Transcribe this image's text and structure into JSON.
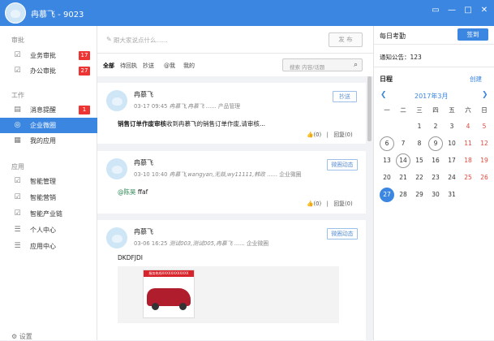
{
  "window": {
    "title": "冉慕飞 - 9023",
    "controls": [
      "▭",
      "—",
      "□",
      "✕"
    ]
  },
  "sidebar": {
    "sections": [
      {
        "title": "审批",
        "items": [
          {
            "label": "业务审批",
            "icon": "checkbox-icon",
            "badge": "17"
          },
          {
            "label": "办公审批",
            "icon": "checkbox-icon",
            "badge": "27"
          }
        ]
      },
      {
        "title": "工作",
        "items": [
          {
            "label": "消息提醒",
            "icon": "message-icon",
            "badge": "1"
          },
          {
            "label": "企业微圈",
            "icon": "circle-icon",
            "badge": "",
            "active": true
          },
          {
            "label": "我的应用",
            "icon": "apps-icon",
            "badge": ""
          }
        ]
      },
      {
        "title": "应用",
        "items": [
          {
            "label": "智能管理",
            "icon": "checkbox-icon",
            "badge": ""
          },
          {
            "label": "智能营销",
            "icon": "checkbox-icon",
            "badge": ""
          },
          {
            "label": "智能产业链",
            "icon": "checkbox-icon",
            "badge": ""
          },
          {
            "label": "个人中心",
            "icon": "list-icon",
            "badge": ""
          },
          {
            "label": "应用中心",
            "icon": "list-icon",
            "badge": ""
          }
        ]
      }
    ],
    "settings_label": "设置"
  },
  "compose": {
    "placeholder": "跟大家说点什么......",
    "publish_label": "发 布"
  },
  "filters": {
    "tabs": [
      "全部",
      "待回执",
      "抄送",
      "@我",
      "我的"
    ],
    "search_placeholder": "搜索 内容/话题"
  },
  "posts": [
    {
      "author": "冉慕飞",
      "time": "03-17 09:45",
      "recipients": "冉慕飞,冉慕飞",
      "scope": "...... 产品管理",
      "tag": "抄送",
      "body_bold": "销售订单作废审核",
      "body": "收到冉慕飞的销售订单作废,请审核...",
      "likes": "(0)",
      "replies": "回复(0)"
    },
    {
      "author": "冉慕飞",
      "time": "03-10 10:40",
      "recipients": "冉慕飞,wangyan,无燚,wy11111,韩政",
      "scope": "...... 企业微圈",
      "tag": "微圈动态",
      "mention": "@陈昊",
      "body": " ffaf",
      "likes": "(0)",
      "replies": "回复(0)"
    },
    {
      "author": "冉慕飞",
      "time": "03-06 16:25",
      "recipients": "测试003,测试005,冉慕飞",
      "scope": "...... 企业微圈",
      "tag": "微圈动态",
      "body": "DKDFJDI",
      "image_header": "服务热线XXXXXXXXXXXX"
    }
  ],
  "attendance": {
    "title": "每日考勤",
    "sign_label": "签到",
    "notice": "通知公告：123"
  },
  "schedule": {
    "title": "日程",
    "create_label": "创建",
    "month": "2017年3月",
    "weekdays": [
      "一",
      "二",
      "三",
      "四",
      "五",
      "六",
      "日"
    ],
    "weeks": [
      [
        "",
        "",
        "1",
        "2",
        "3",
        "4",
        "5"
      ],
      [
        "6",
        "7",
        "8",
        "9",
        "10",
        "11",
        "12"
      ],
      [
        "13",
        "14",
        "15",
        "16",
        "17",
        "18",
        "19"
      ],
      [
        "20",
        "21",
        "22",
        "23",
        "24",
        "25",
        "26"
      ],
      [
        "27",
        "28",
        "29",
        "30",
        "31",
        "",
        ""
      ]
    ],
    "today": "27",
    "marked_days": [
      "6",
      "9",
      "14"
    ]
  },
  "colors": {
    "accent": "#3b86e0",
    "badge": "#e33333",
    "weekend": "#e0463b"
  }
}
